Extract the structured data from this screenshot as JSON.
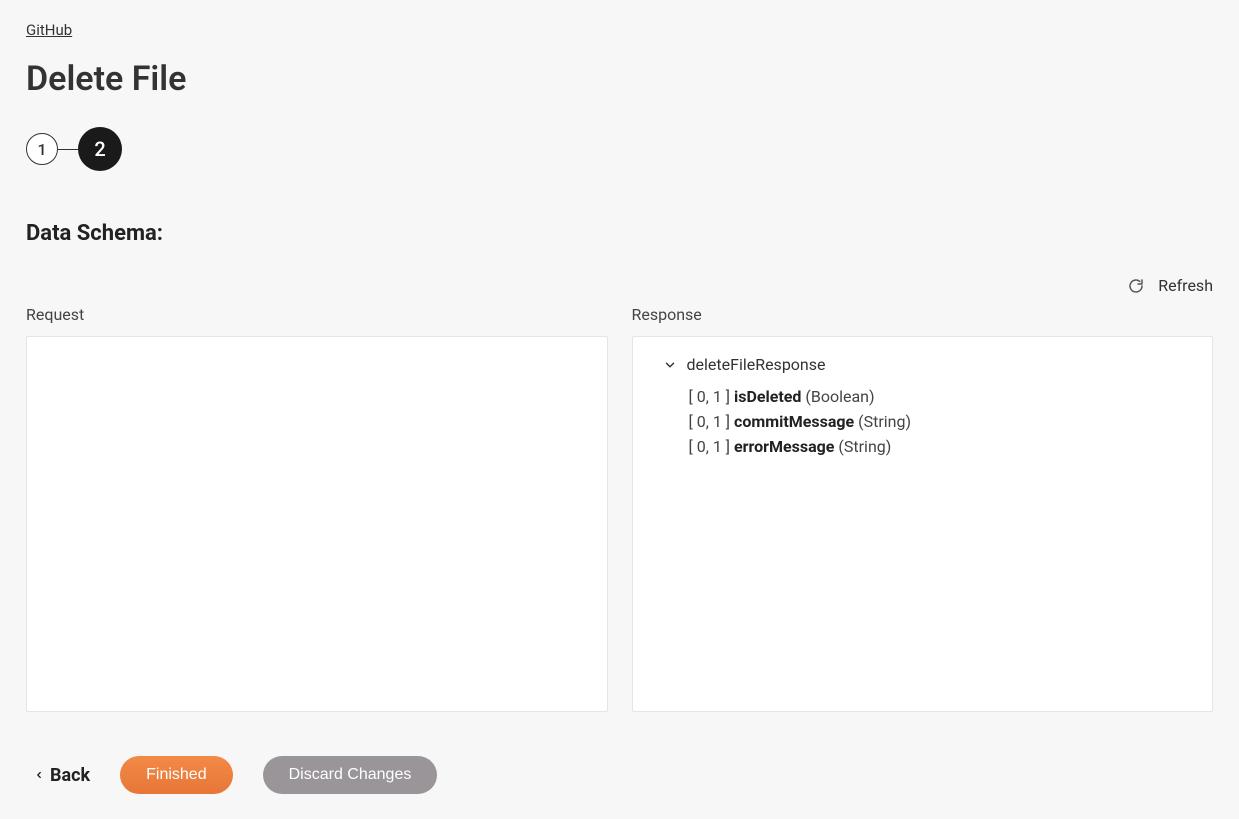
{
  "breadcrumb": {
    "link": "GitHub"
  },
  "page": {
    "title": "Delete File"
  },
  "stepper": {
    "step1": "1",
    "step2": "2"
  },
  "section": {
    "title": "Data Schema:"
  },
  "refresh": {
    "label": "Refresh"
  },
  "panels": {
    "request": {
      "label": "Request"
    },
    "response": {
      "label": "Response",
      "root": "deleteFileResponse",
      "fields": [
        {
          "cardinality": "[ 0, 1 ]",
          "name": "isDeleted",
          "type": "(Boolean)"
        },
        {
          "cardinality": "[ 0, 1 ]",
          "name": "commitMessage",
          "type": "(String)"
        },
        {
          "cardinality": "[ 0, 1 ]",
          "name": "errorMessage",
          "type": "(String)"
        }
      ]
    }
  },
  "footer": {
    "back": "Back",
    "finished": "Finished",
    "discard": "Discard Changes"
  }
}
